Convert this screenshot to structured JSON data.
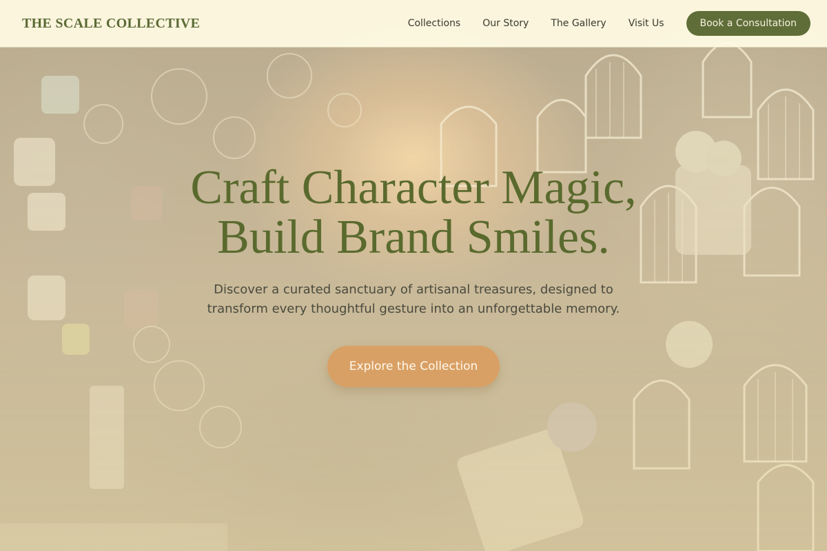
{
  "header": {
    "logo_text": "THE SCALE COLLECTIVE",
    "nav": [
      {
        "label": "Collections"
      },
      {
        "label": "Our Story"
      },
      {
        "label": "The Gallery"
      },
      {
        "label": "Visit Us"
      }
    ],
    "cta_label": "Book a Consultation"
  },
  "hero": {
    "headline_line1": "Craft Character Magic,",
    "headline_line2": "Build Brand Smiles.",
    "subhead": "Discover a curated sanctuary of artisanal treasures, designed to transform every thoughtful gesture into an unforgettable memory.",
    "button_label": "Explore the Collection"
  },
  "colors": {
    "brand_green": "#5f6d38",
    "accent_orange": "#d9a065",
    "header_bg": "#fffae2"
  }
}
